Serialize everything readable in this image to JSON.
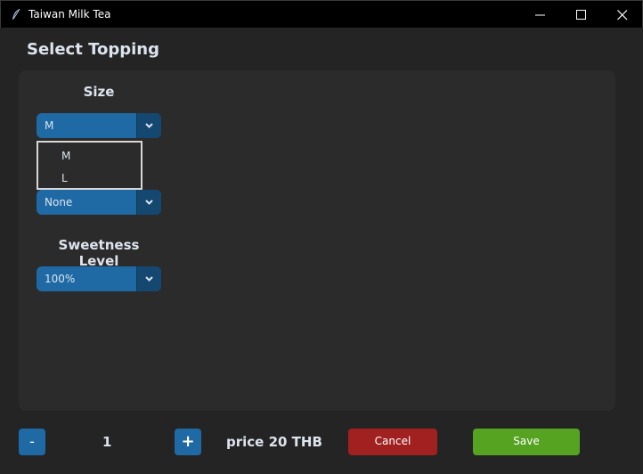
{
  "window": {
    "title": "Taiwan Milk Tea"
  },
  "page": {
    "heading": "Select Topping"
  },
  "size": {
    "label": "Size",
    "selected": "M",
    "options": [
      "M",
      "L"
    ]
  },
  "topping": {
    "selected": "None"
  },
  "sweetness": {
    "label": "Sweetness Level",
    "selected": "100%"
  },
  "footer": {
    "minus_label": "-",
    "quantity": "1",
    "plus_label": "+",
    "price_text": "price 20 THB",
    "cancel_label": "Cancel",
    "save_label": "Save"
  },
  "colors": {
    "accent": "#1f6aa5",
    "cancel": "#a12020",
    "save": "#55a321"
  }
}
